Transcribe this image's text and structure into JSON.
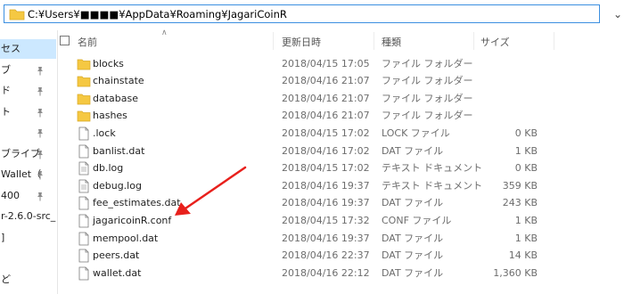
{
  "address_bar": {
    "path": "C:¥Users¥■■■■¥AppData¥Roaming¥JagariCoinR"
  },
  "nav": {
    "items": [
      {
        "label": "セス",
        "selected": true,
        "pinned": false
      },
      {
        "label": "ブ",
        "selected": false,
        "pinned": true
      },
      {
        "label": "ド",
        "selected": false,
        "pinned": true
      },
      {
        "label": "ト",
        "selected": false,
        "pinned": true
      },
      {
        "label": "",
        "selected": false,
        "pinned": true
      },
      {
        "label": "ブライブ",
        "selected": false,
        "pinned": true
      },
      {
        "label": "Wallet（",
        "selected": false,
        "pinned": true
      },
      {
        "label": "400",
        "selected": false,
        "pinned": true
      },
      {
        "label": "r-2.6.0-src_",
        "selected": false,
        "pinned": false
      },
      {
        "label": "]",
        "selected": false,
        "pinned": false
      },
      {
        "label": "",
        "selected": false,
        "pinned": false
      },
      {
        "label": "ど",
        "selected": false,
        "pinned": false
      }
    ]
  },
  "columns": {
    "name": "名前",
    "date": "更新日時",
    "type": "種類",
    "size": "サイズ"
  },
  "files": [
    {
      "name": "blocks",
      "date": "2018/04/15 17:05",
      "type": "ファイル フォルダー",
      "size": "",
      "icon": "folder-icon"
    },
    {
      "name": "chainstate",
      "date": "2018/04/16 21:07",
      "type": "ファイル フォルダー",
      "size": "",
      "icon": "folder-icon"
    },
    {
      "name": "database",
      "date": "2018/04/16 21:07",
      "type": "ファイル フォルダー",
      "size": "",
      "icon": "folder-icon"
    },
    {
      "name": "hashes",
      "date": "2018/04/16 21:07",
      "type": "ファイル フォルダー",
      "size": "",
      "icon": "folder-icon"
    },
    {
      "name": ".lock",
      "date": "2018/04/15 17:02",
      "type": "LOCK ファイル",
      "size": "0 KB",
      "icon": "file-icon"
    },
    {
      "name": "banlist.dat",
      "date": "2018/04/16 17:02",
      "type": "DAT ファイル",
      "size": "1 KB",
      "icon": "file-icon"
    },
    {
      "name": "db.log",
      "date": "2018/04/15 17:02",
      "type": "テキスト ドキュメント",
      "size": "0 KB",
      "icon": "text-file-icon"
    },
    {
      "name": "debug.log",
      "date": "2018/04/16 19:37",
      "type": "テキスト ドキュメント",
      "size": "359 KB",
      "icon": "text-file-icon"
    },
    {
      "name": "fee_estimates.dat",
      "date": "2018/04/16 19:37",
      "type": "DAT ファイル",
      "size": "243 KB",
      "icon": "file-icon"
    },
    {
      "name": "jagaricoinR.conf",
      "date": "2018/04/15 17:32",
      "type": "CONF ファイル",
      "size": "1 KB",
      "icon": "file-icon"
    },
    {
      "name": "mempool.dat",
      "date": "2018/04/16 19:37",
      "type": "DAT ファイル",
      "size": "1 KB",
      "icon": "file-icon"
    },
    {
      "name": "peers.dat",
      "date": "2018/04/16 22:37",
      "type": "DAT ファイル",
      "size": "14 KB",
      "icon": "file-icon"
    },
    {
      "name": "wallet.dat",
      "date": "2018/04/16 22:12",
      "type": "DAT ファイル",
      "size": "1,360 KB",
      "icon": "file-icon"
    }
  ],
  "colors": {
    "folder": "#f5c842",
    "selection": "#cce8ff",
    "address_border": "#3c8fe0",
    "annotation_arrow": "#e8201c"
  }
}
